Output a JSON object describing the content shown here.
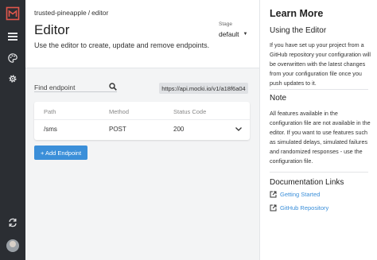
{
  "breadcrumb": {
    "project": "trusted-pineapple",
    "separator": "/",
    "current": "editor"
  },
  "header": {
    "title": "Editor",
    "subtitle": "Use the editor to create, update and remove endpoints.",
    "stage_label": "Stage",
    "stage_value": "default"
  },
  "search": {
    "placeholder": "Find endpoint",
    "value": ""
  },
  "api_url": "https://api.mocki.io/v1/a18f6a04",
  "table": {
    "columns": [
      "Path",
      "Method",
      "Status Code"
    ],
    "rows": [
      {
        "path": "/sms",
        "method": "POST",
        "status": "200"
      }
    ]
  },
  "add_button_label": "+ Add Endpoint",
  "sidebar": {
    "icons": [
      "logo-icon",
      "list-icon",
      "palette-icon",
      "settings-icon",
      "sync-icon"
    ]
  },
  "panel": {
    "title": "Learn More",
    "using_heading": "Using the Editor",
    "using_text": "If you have set up your project from a GitHub repository your configuration will be overwritten with the latest changes from your configuration file once you push updates to it.",
    "note_heading": "Note",
    "note_text": "All features available in the configuration file are not available in the editor. If you want to use features such as simulated delays, simulated failures and randomized responses - use the configuration file.",
    "docs_heading": "Documentation Links",
    "links": [
      "Getting Started",
      "GitHub Repository"
    ]
  },
  "colors": {
    "sidebar": "#2b2e33",
    "accent": "#3b8fd9",
    "background": "#f3f4f5"
  }
}
